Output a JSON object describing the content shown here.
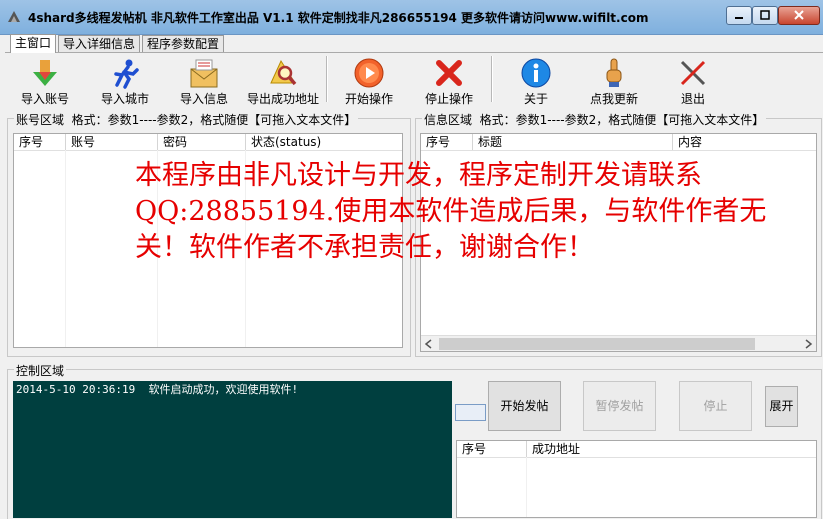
{
  "window": {
    "title": "4shard多线程发帖机 非凡软件工作室出品 V1.1  软件定制找非凡286655194 更多软件请访问www.wifilt.com"
  },
  "tabs": [
    "主窗口",
    "导入详细信息",
    "程序参数配置"
  ],
  "toolbar": {
    "import_accounts": "导入账号",
    "import_cities": "导入城市",
    "import_info": "导入信息",
    "export_success": "导出成功地址",
    "start": "开始操作",
    "stop": "停止操作",
    "about": "关于",
    "update": "点我更新",
    "exit": "退出"
  },
  "accounts": {
    "title": "账号区域",
    "format": "格式：参数1----参数2，格式随便【可拖入文本文件】",
    "columns": [
      "序号",
      "账号",
      "密码",
      "状态(status)"
    ]
  },
  "info": {
    "title": "信息区域",
    "format": "格式：参数1----参数2，格式随便【可拖入文本文件】",
    "columns": [
      "序号",
      "标题",
      "内容"
    ]
  },
  "notice": {
    "line1": "本程序由非凡设计与开发，程序定制开发请联系",
    "line2": "QQ:28855194.使用本软件造成后果，与软件作者无",
    "line3": "关！软件作者不承担责任，谢谢合作！"
  },
  "control": {
    "title": "控制区域",
    "log": "2014-5-10 20:36:19  软件启动成功，欢迎使用软件!",
    "start_post": "开始发帖",
    "pause_post": "暂停发帖",
    "stop": "停止",
    "expand": "展开",
    "columns": [
      "序号",
      "成功地址"
    ]
  },
  "colors": {
    "notice": "#e60000",
    "log_bg": "#003f3f"
  },
  "icons": [
    "app-icon",
    "import-arrow-icon",
    "running-man-icon",
    "envelope-icon",
    "magnifier-icon",
    "play-icon",
    "red-x-icon",
    "info-icon",
    "pointing-hand-icon",
    "exit-icon"
  ]
}
